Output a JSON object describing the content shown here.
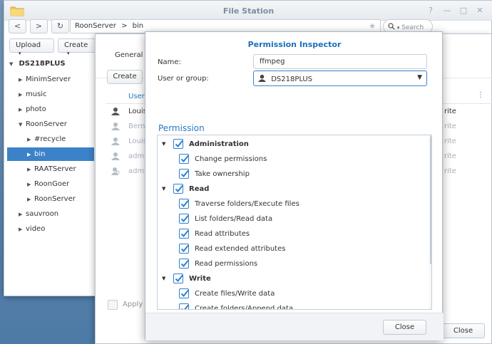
{
  "window": {
    "title": "File Station",
    "controls": [
      "?",
      "—",
      "□",
      "✕"
    ]
  },
  "toolbar": {
    "back": "<",
    "forward": ">",
    "refresh": "↻",
    "path": [
      "RoonServer",
      "bin"
    ],
    "path_separator": ">",
    "search_placeholder": "Search",
    "upload": "Upload",
    "create": "Create"
  },
  "sidebar": {
    "root": "DS218PLUS",
    "items": [
      {
        "label": "MinimServer",
        "level": 1
      },
      {
        "label": "music",
        "level": 1
      },
      {
        "label": "photo",
        "level": 1
      },
      {
        "label": "RoonServer",
        "level": 1,
        "expanded": true
      },
      {
        "label": "#recycle",
        "level": 2
      },
      {
        "label": "bin",
        "level": 2,
        "selected": true
      },
      {
        "label": "RAATServer",
        "level": 2
      },
      {
        "label": "RoonGoer",
        "level": 2
      },
      {
        "label": "RoonServer",
        "level": 2
      },
      {
        "label": "sauvroon",
        "level": 1
      },
      {
        "label": "video",
        "level": 1
      }
    ]
  },
  "properties": {
    "tab_general": "General",
    "create_button": "Create",
    "column_user": "User",
    "rows": [
      {
        "user": "Louis",
        "perm": "rite",
        "dim": false
      },
      {
        "user": "Berna",
        "perm": "rite",
        "dim": true
      },
      {
        "user": "Louis",
        "perm": "rite",
        "dim": true
      },
      {
        "user": "admin",
        "perm": "rite",
        "dim": true
      },
      {
        "user": "admin",
        "perm": "rite",
        "dim": true
      }
    ],
    "apply_label": "Apply t",
    "close": "Close"
  },
  "inspector": {
    "title": "Permission Inspector",
    "name_label": "Name:",
    "name_value": "ffmpeg",
    "user_label": "User or group:",
    "user_value": "DS218PLUS",
    "section": "Permission",
    "groups": [
      {
        "label": "Administration",
        "items": [
          "Change permissions",
          "Take ownership"
        ]
      },
      {
        "label": "Read",
        "items": [
          "Traverse folders/Execute files",
          "List folders/Read data",
          "Read attributes",
          "Read extended attributes",
          "Read permissions"
        ]
      },
      {
        "label": "Write",
        "items": [
          "Create files/Write data",
          "Create folders/Append data"
        ]
      }
    ],
    "close": "Close"
  },
  "colors": {
    "accent": "#3b82c9",
    "title_blue": "#1e6fb8",
    "checkbox": "#2f7fd0"
  }
}
